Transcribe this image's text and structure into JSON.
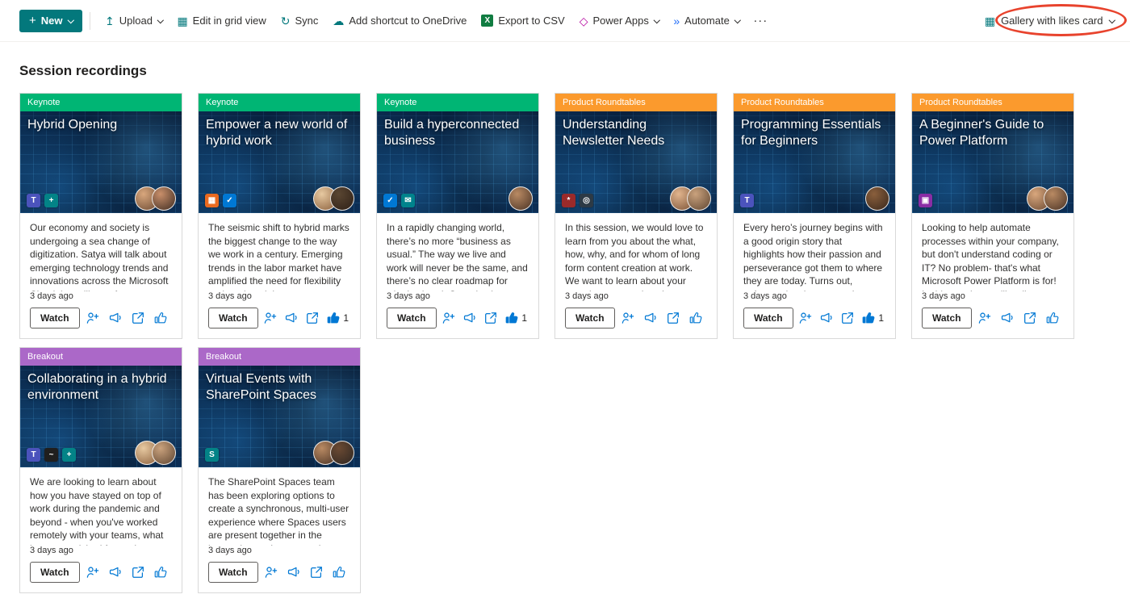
{
  "toolbar": {
    "new_button": {
      "label": "New",
      "plus_glyph": "+"
    },
    "items": [
      {
        "name": "upload-button",
        "label": "Upload",
        "icon": "upload-icon",
        "glyph": "↥",
        "color": "#03787c",
        "chevron": true
      },
      {
        "name": "edit-grid-view-button",
        "label": "Edit in grid view",
        "icon": "grid-icon",
        "glyph": "▦",
        "color": "#03787c",
        "chevron": false
      },
      {
        "name": "sync-button",
        "label": "Sync",
        "icon": "sync-icon",
        "glyph": "↻",
        "color": "#03787c",
        "chevron": false
      },
      {
        "name": "add-shortcut-onedrive-button",
        "label": "Add shortcut to OneDrive",
        "icon": "onedrive-icon",
        "glyph": "☁",
        "color": "#03787c",
        "chevron": false
      },
      {
        "name": "export-csv-button",
        "label": "Export to CSV",
        "icon": "excel-icon",
        "glyph": "X",
        "color": "#ffffff",
        "bg": "#107c41",
        "chevron": false
      },
      {
        "name": "power-apps-button",
        "label": "Power Apps",
        "icon": "power-apps-icon",
        "glyph": "◇",
        "color": "#b4009e",
        "chevron": true
      },
      {
        "name": "automate-button",
        "label": "Automate",
        "icon": "automate-icon",
        "glyph": "»",
        "color": "#1f6cf9",
        "chevron": true
      }
    ],
    "more_label": "···",
    "view_selector": {
      "label": "Gallery with likes card",
      "glyph": "▦"
    }
  },
  "page": {
    "title": "Session recordings"
  },
  "card_actions": {
    "watch_label": "Watch"
  },
  "cards": [
    {
      "category": "Keynote",
      "category_color": "#00b574",
      "title": "Hybrid Opening",
      "description": "Our economy and society is undergoing a sea change of digitization. Satya will talk about emerging technology trends and innovations across the Microsoft Cloud that will transform ...",
      "age": "3 days ago",
      "likes": 0,
      "app_icons": [
        {
          "name": "teams-app-icon",
          "color": "#4b53bc",
          "glyph": "T"
        },
        {
          "name": "shield-app-icon",
          "color": "#038387",
          "glyph": "+"
        }
      ],
      "avatars": [
        {
          "c1": "#d9a77d",
          "c2": "#6b4a33"
        },
        {
          "c1": "#c98f6a",
          "c2": "#3e2c22"
        }
      ]
    },
    {
      "category": "Keynote",
      "category_color": "#00b574",
      "title": "Empower a new world of hybrid work",
      "description": "The seismic shift to hybrid marks the biggest change to the way we work in a century. Emerging trends in the labor market have amplified the need for flexibility and a reimagining ...",
      "age": "3 days ago",
      "likes": 1,
      "app_icons": [
        {
          "name": "office-grid-app-icon",
          "color": "#ea6a1f",
          "glyph": "▦"
        },
        {
          "name": "pen-check-app-icon",
          "color": "#0078d4",
          "glyph": "✓"
        }
      ],
      "avatars": [
        {
          "c1": "#e7c9a1",
          "c2": "#8a5f3c"
        },
        {
          "c1": "#5a4632",
          "c2": "#2e2017"
        }
      ]
    },
    {
      "category": "Keynote",
      "category_color": "#00b574",
      "title": "Build a hyperconnected business",
      "description": "In a rapidly changing world, there’s no more “business as usual.” The way we live and work will never be the same, and there’s no clear roadmap for what’s ahead. Organizations need...",
      "age": "3 days ago",
      "likes": 1,
      "app_icons": [
        {
          "name": "pen-check-app-icon",
          "color": "#0078d4",
          "glyph": "✓"
        },
        {
          "name": "mail-app-icon",
          "color": "#00838c",
          "glyph": "✉"
        }
      ],
      "avatars": [
        {
          "c1": "#b98a63",
          "c2": "#4a3325"
        }
      ]
    },
    {
      "category": "Product Roundtables",
      "category_color": "#fb9a2d",
      "title": "Understanding Newsletter Needs",
      "description": "In this session, we would love to learn from you about the what, how, why, and for whom of long form content creation at work. We want to learn about your experiences creating shar...",
      "age": "3 days ago",
      "likes": 0,
      "app_icons": [
        {
          "name": "pinwheel-app-icon",
          "color": "#9a2a2a",
          "glyph": "*"
        },
        {
          "name": "disc-app-icon",
          "color": "#2d3a45",
          "glyph": "◎"
        }
      ],
      "avatars": [
        {
          "c1": "#e2b58e",
          "c2": "#7a5236"
        },
        {
          "c1": "#caa27d",
          "c2": "#5f4632"
        }
      ]
    },
    {
      "category": "Product Roundtables",
      "category_color": "#fb9a2d",
      "title": "Programming Essentials for Beginners",
      "description": "Every hero’s journey begins with a good origin story that highlights how their passion and perseverance got them to where they are today. Turns out, software developers aren’t much...",
      "age": "3 days ago",
      "likes": 1,
      "app_icons": [
        {
          "name": "teams-app-icon",
          "color": "#4b53bc",
          "glyph": "T"
        }
      ],
      "avatars": [
        {
          "c1": "#8a5f3c",
          "c2": "#3a281c"
        }
      ]
    },
    {
      "category": "Product Roundtables",
      "category_color": "#fb9a2d",
      "title": "A Beginner's Guide to Power Platform",
      "description": "Looking to help automate processes within your company, but don't understand coding or IT? No problem- that's what Microsoft Power Platform is for! In this session, we'll walk you ...",
      "age": "3 days ago",
      "likes": 0,
      "app_icons": [
        {
          "name": "video-app-icon",
          "color": "#8a2da5",
          "glyph": "▣"
        }
      ],
      "avatars": [
        {
          "c1": "#d9a77d",
          "c2": "#6b4a33"
        },
        {
          "c1": "#b98a63",
          "c2": "#4a3325"
        }
      ]
    },
    {
      "category": "Breakout",
      "category_color": "#ab68c8",
      "title": "Collaborating in a hybrid environment",
      "description": "We are looking to learn about how you have stayed on top of work during the pandemic and beyond - when you've worked remotely with your teams, what have you wished for so that you ...",
      "age": "3 days ago",
      "likes": 0,
      "app_icons": [
        {
          "name": "teams-app-icon",
          "color": "#4b53bc",
          "glyph": "T"
        },
        {
          "name": "signature-app-icon",
          "color": "#201f1e",
          "glyph": "~"
        },
        {
          "name": "shield-app-icon",
          "color": "#038387",
          "glyph": "+"
        }
      ],
      "avatars": [
        {
          "c1": "#e7c9a1",
          "c2": "#8a5f3c"
        },
        {
          "c1": "#caa27d",
          "c2": "#5f4632"
        }
      ]
    },
    {
      "category": "Breakout",
      "category_color": "#ab68c8",
      "title": "Virtual Events with SharePoint Spaces",
      "description": "The SharePoint Spaces team has been exploring options to create a synchronous, multi-user experience where Spaces users are present together in the immersive environments they crea...",
      "age": "3 days ago",
      "likes": 0,
      "app_icons": [
        {
          "name": "sharepoint-app-icon",
          "color": "#038387",
          "glyph": "S"
        }
      ],
      "avatars": [
        {
          "c1": "#b98a63",
          "c2": "#4a3325"
        },
        {
          "c1": "#6b4a33",
          "c2": "#2f2722"
        }
      ]
    }
  ]
}
